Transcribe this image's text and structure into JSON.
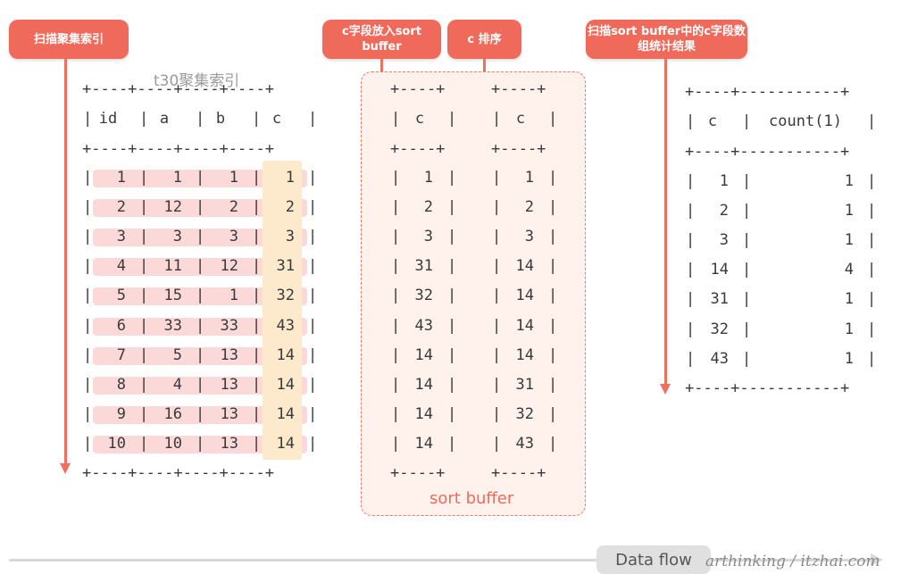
{
  "labels": {
    "scan_clustered": "扫描聚集索引",
    "put_c_sort_buffer": "c字段放入sort buffer",
    "c_sort": "c 排序",
    "scan_sort_buffer_group": "扫描sort buffer中的c字段数组统计结果",
    "table_caption": "t30聚集索引",
    "sort_buffer_caption": "sort buffer",
    "data_flow": "Data flow",
    "watermark": "arthinking / itzhai.com"
  },
  "border_line": "+----+----+----+----+",
  "table1": {
    "headers": [
      "id",
      "a",
      "b",
      "c"
    ],
    "rows": [
      [
        "1",
        "1",
        "1",
        "1"
      ],
      [
        "2",
        "12",
        "2",
        "2"
      ],
      [
        "3",
        "3",
        "3",
        "3"
      ],
      [
        "4",
        "11",
        "12",
        "31"
      ],
      [
        "5",
        "15",
        "1",
        "32"
      ],
      [
        "6",
        "33",
        "33",
        "43"
      ],
      [
        "7",
        "5",
        "13",
        "14"
      ],
      [
        "8",
        "4",
        "13",
        "14"
      ],
      [
        "9",
        "16",
        "13",
        "14"
      ],
      [
        "10",
        "10",
        "13",
        "14"
      ]
    ]
  },
  "small_border": "+----+",
  "buffer_unsorted": {
    "header": "c",
    "values": [
      "1",
      "2",
      "3",
      "31",
      "32",
      "43",
      "14",
      "14",
      "14",
      "14"
    ]
  },
  "buffer_sorted": {
    "header": "c",
    "values": [
      "1",
      "2",
      "3",
      "14",
      "14",
      "14",
      "14",
      "31",
      "32",
      "43"
    ]
  },
  "result_border": "+----+-----------+",
  "result": {
    "headers": [
      "c",
      "count(1)"
    ],
    "rows": [
      [
        "1",
        "1"
      ],
      [
        "2",
        "1"
      ],
      [
        "3",
        "1"
      ],
      [
        "14",
        "4"
      ],
      [
        "31",
        "1"
      ],
      [
        "32",
        "1"
      ],
      [
        "43",
        "1"
      ]
    ]
  },
  "colors": {
    "accent": "#f06a5c",
    "row_highlight": "#fbd9d9",
    "col_highlight": "#fde9cc",
    "buffer_bg": "#fff1ec"
  }
}
